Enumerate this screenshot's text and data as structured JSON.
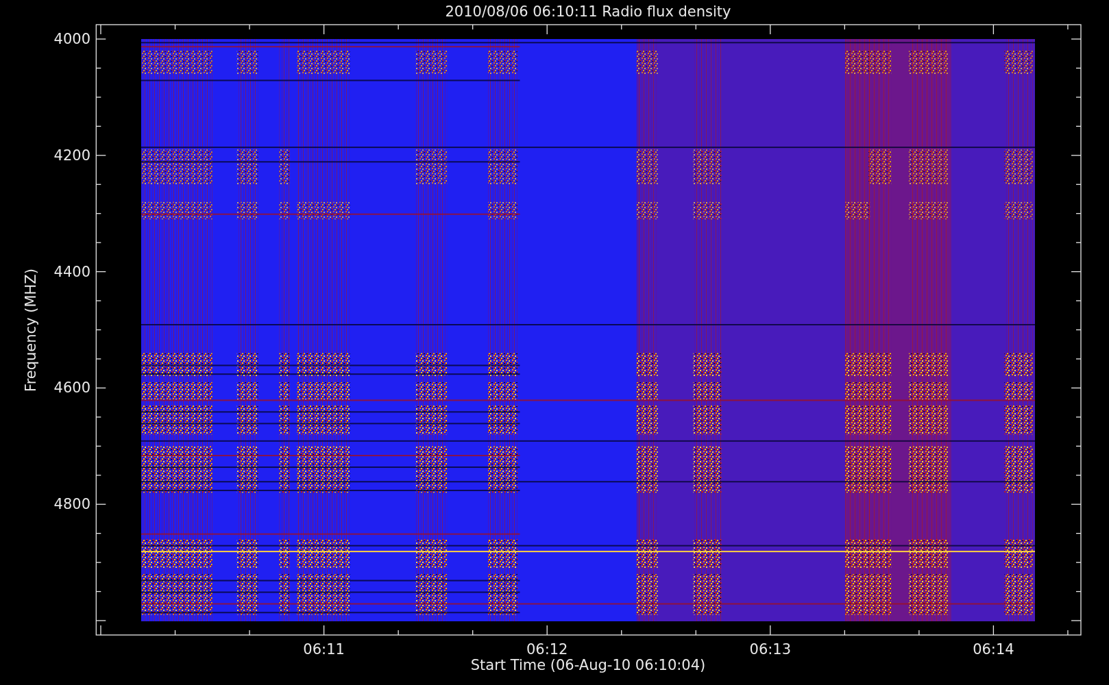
{
  "title": "2010/08/06 06:10:11 Radio flux density",
  "y_axis": {
    "label": "Frequency (MHZ)",
    "ticks": [
      "4000",
      "4200",
      "4400",
      "4600",
      "4800"
    ]
  },
  "x_axis": {
    "label": "Start Time (06-Aug-10 06:10:04)",
    "ticks": [
      "06:11",
      "06:12",
      "06:13",
      "06:14"
    ]
  }
}
